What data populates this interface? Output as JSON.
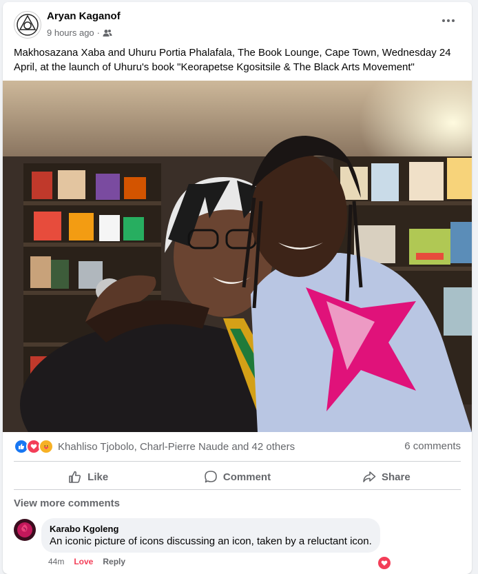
{
  "post": {
    "author": "Aryan Kaganof",
    "time": "9 hours ago",
    "separator": "·",
    "audience_icon": "friends-icon",
    "caption": "Makhosazana Xaba and Uhuru Portia Phalafala, The Book Lounge, Cape Town, Wednesday 24 April, at the launch of Uhuru's book \"Keorapetse Kgositsile & The Black Arts Movement\""
  },
  "reactions": {
    "icons": [
      "like-icon",
      "love-icon",
      "care-icon"
    ],
    "names": "Khahliso Tjobolo, Charl-Pierre Naude and 42 others",
    "comments": "6 comments"
  },
  "actions": {
    "like": "Like",
    "comment": "Comment",
    "share": "Share"
  },
  "comments": {
    "view_more": "View more comments",
    "items": [
      {
        "name": "Karabo Kgoleng",
        "text": "An iconic picture of icons discussing an icon, taken by a reluctant icon.",
        "time": "44m",
        "love": "Love",
        "reply": "Reply"
      }
    ]
  },
  "colors": {
    "like_blue": "#1877f2",
    "love_red": "#f33e58",
    "care_yellow": "#f7b125",
    "text_secondary": "#65676b"
  }
}
